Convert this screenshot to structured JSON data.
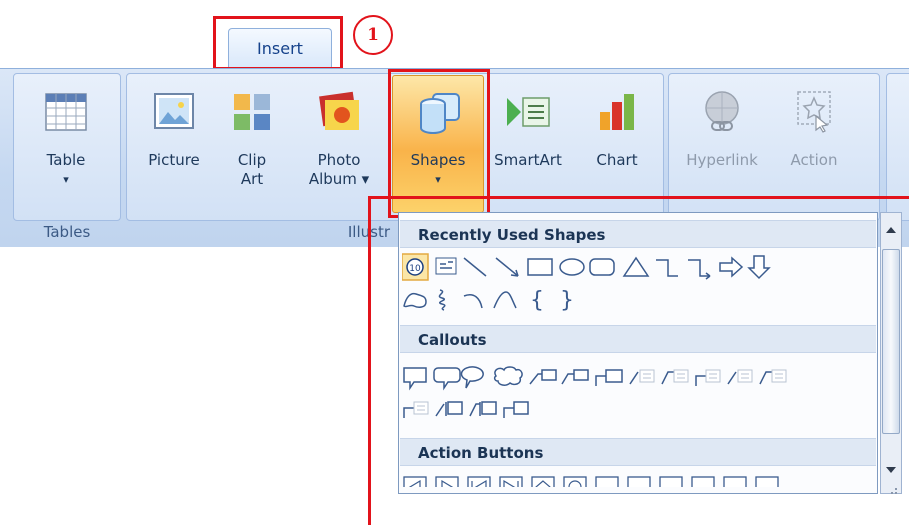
{
  "tab": {
    "label": "Insert"
  },
  "step": {
    "number": "1"
  },
  "ribbon": {
    "groups": {
      "tables": "Tables",
      "illustrations": "Illustr"
    },
    "buttons": {
      "table": {
        "line1": "Table",
        "line2": "▾"
      },
      "picture": {
        "line1": "Picture"
      },
      "clip_art": {
        "line1": "Clip",
        "line2": "Art"
      },
      "photo_album": {
        "line1": "Photo",
        "line2": "Album ▾"
      },
      "shapes": {
        "line1": "Shapes",
        "line2": "▾"
      },
      "smartart": {
        "line1": "SmartArt"
      },
      "chart": {
        "line1": "Chart"
      },
      "hyperlink": {
        "line1": "Hyperlink"
      },
      "action": {
        "line1": "Action"
      }
    }
  },
  "gallery": {
    "sections": {
      "recent": "Recently Used Shapes",
      "callouts": "Callouts",
      "action_buttons": "Action Buttons"
    },
    "recent_badge": "10"
  },
  "colors": {
    "highlight": "#e2131b",
    "ribbon": "#c5d8f1",
    "shapes_active": "#f9b34a",
    "text": "#1e395b"
  }
}
